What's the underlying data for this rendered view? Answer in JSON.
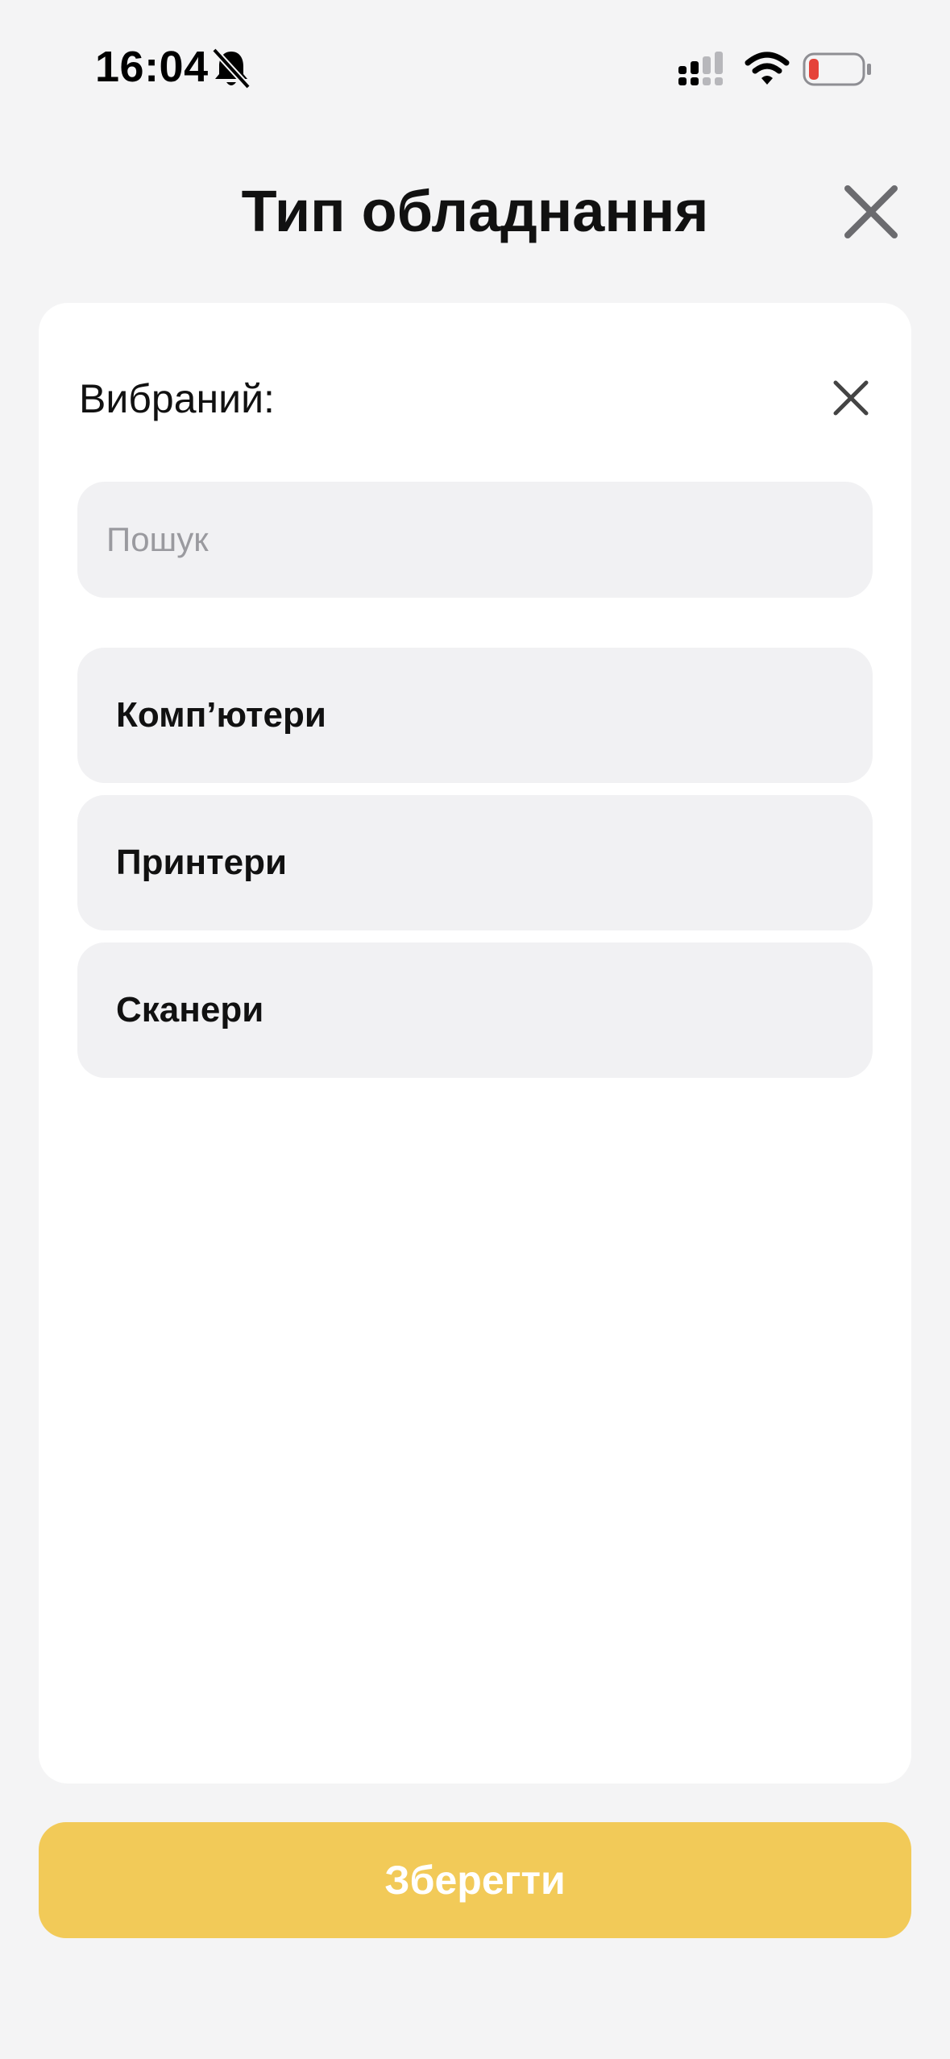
{
  "status_bar": {
    "time": "16:04",
    "icons": [
      "bell-slash-icon",
      "signal-icon",
      "wifi-icon",
      "battery-low-icon"
    ],
    "battery_color": "#e5433a"
  },
  "header": {
    "title": "Тип обладнання",
    "close_icon": "close-icon"
  },
  "card": {
    "selected_label": "Вибраний:",
    "clear_icon": "close-icon"
  },
  "search": {
    "placeholder": "Пошук",
    "value": ""
  },
  "options": [
    {
      "label": "Комп’ютери"
    },
    {
      "label": "Принтери"
    },
    {
      "label": "Сканери"
    }
  ],
  "actions": {
    "save_label": "Зберегти"
  },
  "colors": {
    "background": "#f4f4f5",
    "card": "#ffffff",
    "item": "#f1f1f3",
    "accent": "#f2ca58"
  }
}
